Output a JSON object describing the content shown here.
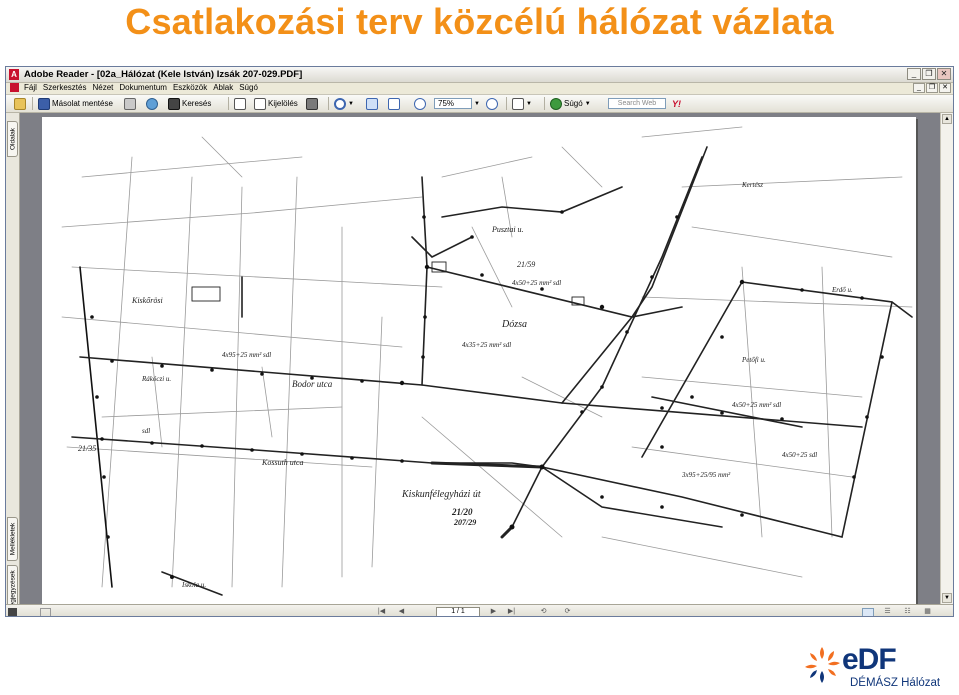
{
  "slide": {
    "title": "Csatlakozási terv közcélú hálózat vázlata"
  },
  "window": {
    "title": "Adobe Reader - [02a_Hálózat (Kele István) Izsák 207-029.PDF]",
    "app_icon": "acrobat-icon",
    "buttons": [
      "_",
      "❐",
      "✕"
    ]
  },
  "menu": {
    "items": [
      "Fájl",
      "Szerkesztés",
      "Nézet",
      "Dokumentum",
      "Eszközök",
      "Ablak",
      "Súgó"
    ],
    "right_buttons": [
      "_",
      "❐",
      "✕"
    ]
  },
  "toolbar": {
    "save_copy": "Másolat mentése",
    "search": "Keresés",
    "select": "Kijelölés",
    "zoom": "75%",
    "help": "Súgó",
    "search_web_placeholder": "Search Web"
  },
  "side_tabs": [
    "Oldalak",
    "Mellékletek",
    "Megjegyzések"
  ],
  "status": {
    "page_indicator": "1 / 1"
  },
  "logo": {
    "brand": "eDF",
    "subtitle": "DÉMÁSZ Hálózat"
  },
  "drawing": {
    "labels": {
      "l1": "Bodor utca",
      "l2": "Kiskunfélegyházi út",
      "l3": "Pusztai u.",
      "l4": "21/59",
      "l5": "21/35",
      "l6": "21/20",
      "l7": "4x50+25 mm² sdl",
      "l8": "4x95+25 mm² sdl",
      "l9": "Dózsa",
      "l10": "4x50+25 mm² sdl",
      "l11": "Kossuth utca",
      "l12": "Rákóczi u.",
      "l13": "3x95+25/95 mm²",
      "l14": "4x35+25 mm² sdl",
      "l15": "Kiskőrösi",
      "l16": "207/29",
      "l17": "Petőfi u.",
      "l18": "Erdő u.",
      "l19": "sdl",
      "l20": "4x50+25 sdl",
      "l21": "Kertész",
      "l22": "Iskola u."
    }
  }
}
